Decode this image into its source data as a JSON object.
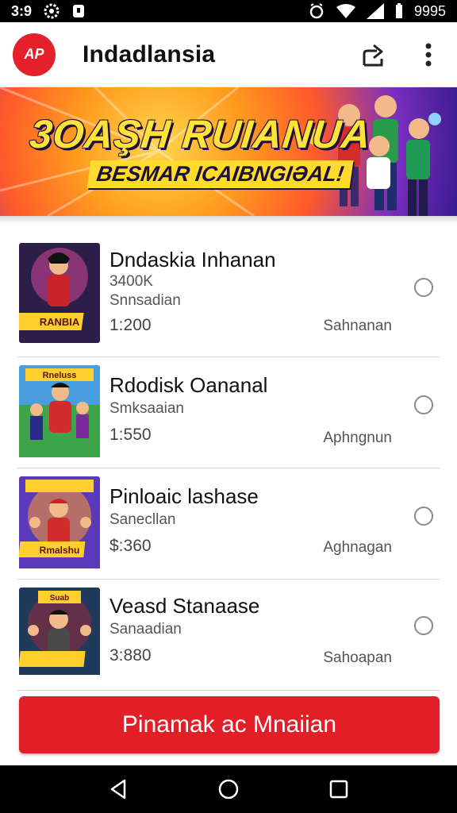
{
  "status_bar": {
    "time": "3:9",
    "battery": "9995",
    "icons": [
      "settings-gear-icon",
      "notification-icon",
      "alarm-icon",
      "wifi-icon",
      "signal-icon",
      "battery-icon"
    ]
  },
  "app_bar": {
    "logo_text": "AP",
    "title": "Indadlansia",
    "actions": [
      "share-icon",
      "more-vert-icon"
    ]
  },
  "banner": {
    "title": "3OAŞH RUIANUA",
    "subtitle": "BESMAR ICAIBNGIƏAL!"
  },
  "games": [
    {
      "name": "Dndaskia Inhanan",
      "downloads": "3400K",
      "category": "Snnsadian",
      "price": "1:200",
      "action": "Sahnanan"
    },
    {
      "name": "Rdodisk Oananal",
      "downloads": "",
      "category": "Smksaaian",
      "price": "1:550",
      "action": "Aphngnun"
    },
    {
      "name": "Pinloaic lashase",
      "downloads": "",
      "category": "Sanecllan",
      "price": "$:360",
      "action": "Aghnagan"
    },
    {
      "name": "Veasd Stanaase",
      "downloads": "",
      "category": "Sanaadian",
      "price": "3:880",
      "action": "Sahoapan"
    }
  ],
  "thumbnails": [
    {
      "caption": "RANBIA"
    },
    {
      "caption": "Rneluss"
    },
    {
      "caption": "Rmalshu"
    },
    {
      "caption": "Suab"
    }
  ],
  "cta": {
    "label": "Pinamak ac Mnaiian"
  },
  "colors": {
    "accent": "#e21f26",
    "banner_yellow": "#ffe23a",
    "divider": "#dcdcdc"
  },
  "nav_bar": [
    "back-icon",
    "home-icon",
    "recents-icon"
  ]
}
